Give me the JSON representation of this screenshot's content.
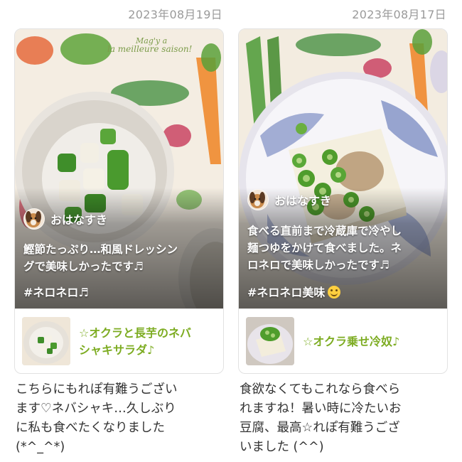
{
  "posts": [
    {
      "date": "2023年08月19日",
      "author": "おはなすき",
      "comment": "鰹節たっぷり…和風ドレッシン\nグで美味しかったです♬",
      "hashtag": "#ネロネロ♬",
      "recipe_title": "☆オクラと長芋のネバ\nシャキサラダ♪",
      "reply": "こちらにもれぽ有難うござい\nます♡ネバシャキ…久しぶり\nに私も食べたくなりました\n(*^_^*)"
    },
    {
      "date": "2023年08月17日",
      "author": "おはなすき",
      "comment": "食べる直前まで冷蔵庫で冷やし\n麺つゆをかけて食べました。ネ\nロネロで美味しかったです♬",
      "hashtag": "#ネロネロ美味",
      "recipe_title": "☆オクラ乗せ冷奴♪",
      "reply": "食欲なくてもこれなら食べら\nれますね！暑い時に冷たいお\n豆腐、最高☆れぽ有難うござ\nいました (^^)"
    }
  ],
  "photo_text": "la meilleure saison!",
  "colors": {
    "recipe_link": "#7dac22",
    "date_text": "#9a9a9a"
  }
}
